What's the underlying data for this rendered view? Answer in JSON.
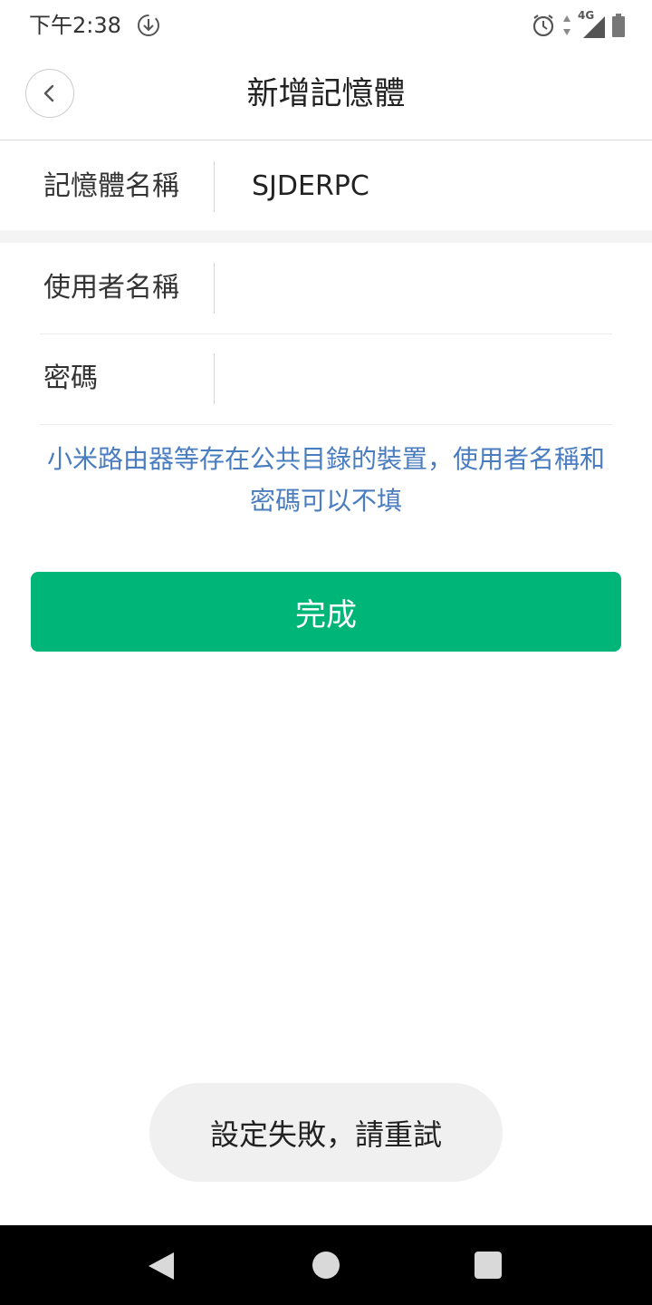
{
  "status_bar": {
    "time": "下午2:38",
    "network": "4G"
  },
  "header": {
    "title": "新增記憶體",
    "back_icon": "chevron-left-icon"
  },
  "form": {
    "storage_name": {
      "label": "記憶體名稱",
      "value": "SJDERPC"
    },
    "username": {
      "label": "使用者名稱",
      "value": ""
    },
    "password": {
      "label": "密碼",
      "value": ""
    }
  },
  "hint": "小米路由器等存在公共目錄的裝置，使用者名稱和密碼可以不填",
  "done_button": {
    "label": "完成"
  },
  "toast": {
    "message": "設定失敗，請重試"
  },
  "colors": {
    "accent": "#00b578",
    "hint": "#4a7cc0"
  }
}
